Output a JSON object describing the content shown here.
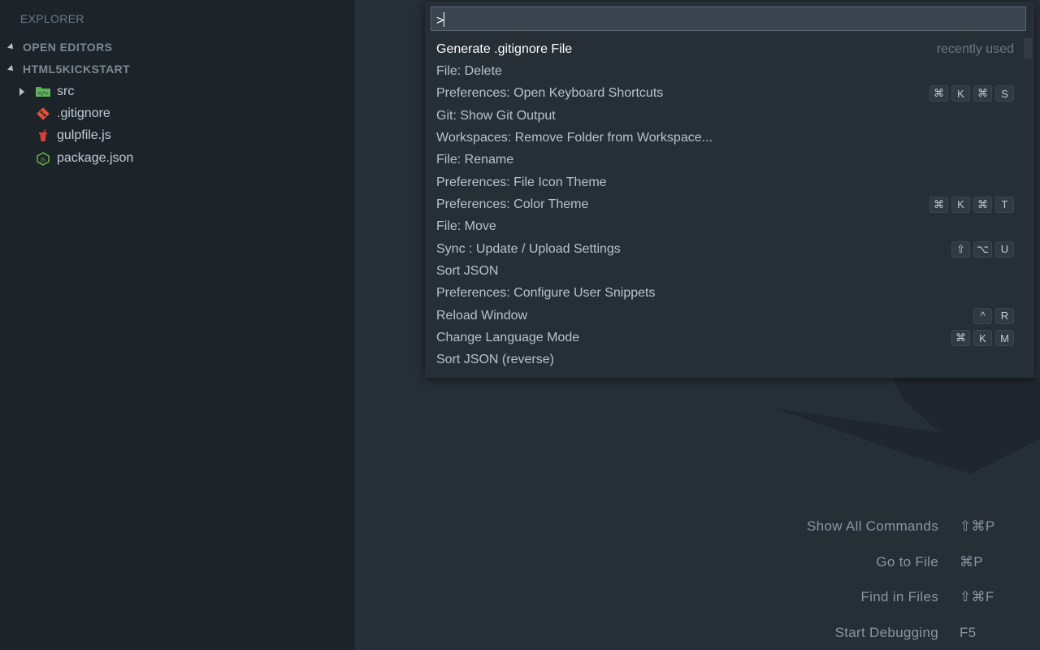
{
  "sidebar": {
    "title": "EXPLORER",
    "sections": [
      {
        "label": "OPEN EDITORS"
      },
      {
        "label": "HTML5KICKSTART"
      }
    ],
    "files": [
      {
        "label": "src",
        "icon": "folder-code-icon",
        "type": "folder"
      },
      {
        "label": ".gitignore",
        "icon": "git-icon",
        "type": "file"
      },
      {
        "label": "gulpfile.js",
        "icon": "gulp-icon",
        "type": "file"
      },
      {
        "label": "package.json",
        "icon": "nodejs-icon",
        "type": "file"
      }
    ]
  },
  "palette": {
    "input_value": ">",
    "recently_used": "recently used",
    "items": [
      {
        "label": "Generate .gitignore File",
        "keys": []
      },
      {
        "label": "File: Delete",
        "keys": []
      },
      {
        "label": "Preferences: Open Keyboard Shortcuts",
        "keys": [
          "⌘",
          "K",
          "⌘",
          "S"
        ]
      },
      {
        "label": "Git: Show Git Output",
        "keys": []
      },
      {
        "label": "Workspaces: Remove Folder from Workspace...",
        "keys": []
      },
      {
        "label": "File: Rename",
        "keys": []
      },
      {
        "label": "Preferences: File Icon Theme",
        "keys": []
      },
      {
        "label": "Preferences: Color Theme",
        "keys": [
          "⌘",
          "K",
          "⌘",
          "T"
        ]
      },
      {
        "label": "File: Move",
        "keys": []
      },
      {
        "label": "Sync : Update / Upload Settings",
        "keys": [
          "⇧",
          "⌥",
          "U"
        ]
      },
      {
        "label": "Sort JSON",
        "keys": []
      },
      {
        "label": "Preferences: Configure User Snippets",
        "keys": []
      },
      {
        "label": "Reload Window",
        "keys": [
          "^",
          "R"
        ]
      },
      {
        "label": "Change Language Mode",
        "keys": [
          "⌘",
          "K",
          "M"
        ]
      },
      {
        "label": "Sort JSON (reverse)",
        "keys": []
      }
    ]
  },
  "hints": [
    {
      "label": "Show All Commands",
      "keys": "⇧⌘P"
    },
    {
      "label": "Go to File",
      "keys": "⌘P"
    },
    {
      "label": "Find in Files",
      "keys": "⇧⌘F"
    },
    {
      "label": "Start Debugging",
      "keys": "F5"
    }
  ],
  "colors": {
    "editor_bg": "#262e36",
    "sidebar_bg": "#1c2329",
    "palette_input_bg": "#3a444e",
    "folder_green": "#5fb05a",
    "git_orange": "#e0523a",
    "gulp_red": "#d9413c",
    "node_green": "#6cbf49"
  }
}
